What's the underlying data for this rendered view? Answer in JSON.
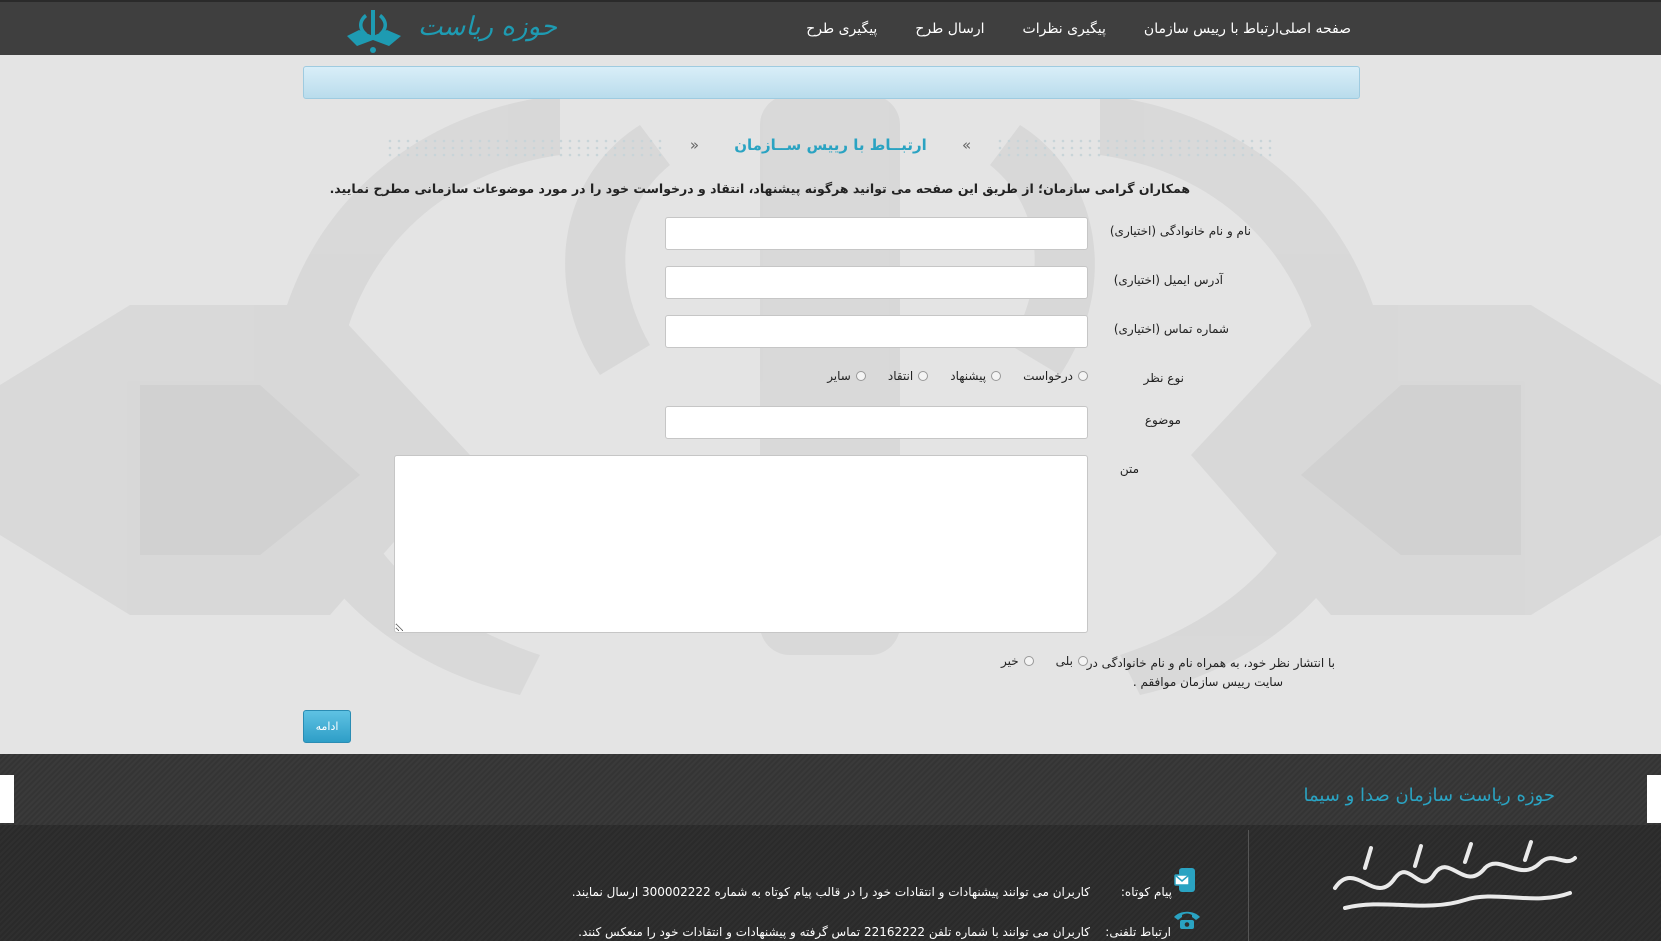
{
  "header": {
    "logo_text": "حوزه ریاست",
    "nav": [
      "صفحه اصلی",
      "ارتباط با رییس سازمان",
      "پیگیری نظرات",
      "ارسال طرح",
      "پیگیری طرح"
    ]
  },
  "section": {
    "title": "ارتبــاط با رییس ســازمان",
    "quote_open": "«",
    "quote_close": "»"
  },
  "form": {
    "intro": "همکاران گرامی سازمان؛ از طریق این صفحه می توانید هرگونه پیشنهاد، انتقاد و درخواست خود را در مورد موضوعات سازمانی مطرح نمایید.",
    "name_label": "نام و نام خانوادگی (اختیاری)",
    "name_value": "",
    "email_label": "آدرس ایمیل (اختیاری)",
    "email_value": "",
    "phone_label": "شماره تماس (اختیاری)",
    "phone_value": "",
    "type_label": "نوع نظر",
    "type_options": [
      "درخواست",
      "پیشنهاد",
      "انتقاد",
      "سایر"
    ],
    "subject_label": "موضوع",
    "subject_value": "",
    "body_label": "متن",
    "body_value": "",
    "publish_label_line1": "با انتشار نظر خود، به همراه نام و نام خانوادگی در",
    "publish_label_line2": "سایت رییس سازمان موافقم .",
    "publish_options": [
      "بلی",
      "خیر"
    ],
    "submit_label": "ادامه"
  },
  "footer": {
    "title": "حوزه ریاست سازمان صدا و سیما",
    "sms_label": "پیام کوتاه:",
    "sms_text": "کاربران می توانند پیشنهادات و انتقادات خود را در قالب پیام کوتاه به شماره 300002222 ارسال نمایند.",
    "phone_label": "ارتباط تلفنی:",
    "phone_text": "کاربران می توانند با شماره تلفن 22162222 تماس گرفته و پیشنهادات و انتقادات خود را منعکس کنند."
  },
  "colors": {
    "accent": "#2aa3c2",
    "topbar": "#3f3f3f",
    "button": "#3aaad3"
  },
  "icons": [
    "emblem-logo-icon",
    "sms-icon",
    "phone-icon",
    "footer-calligraphy-logo"
  ]
}
